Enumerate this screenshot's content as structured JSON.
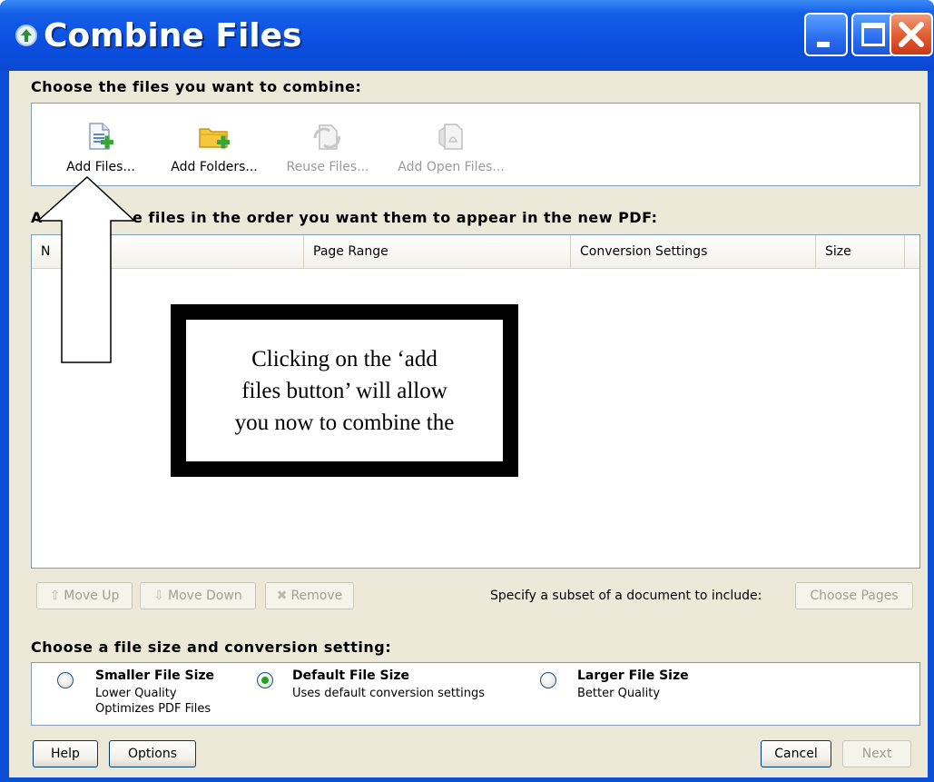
{
  "window": {
    "title": "Combine Files"
  },
  "choose_section": {
    "title": "Choose the files you want to combine:",
    "tools": [
      {
        "label": "Add Files...",
        "enabled": true,
        "icon": "add-files-icon"
      },
      {
        "label": "Add Folders...",
        "enabled": true,
        "icon": "add-folders-icon"
      },
      {
        "label": "Reuse Files...",
        "enabled": false,
        "icon": "reuse-files-icon"
      },
      {
        "label": "Add Open Files...",
        "enabled": false,
        "icon": "add-open-files-icon"
      }
    ]
  },
  "arrange_section": {
    "title_visible_start": "A",
    "title_visible_end": "e files in the order you want them to appear in the new PDF:",
    "columns": [
      "N",
      "Page Range",
      "Conversion Settings",
      "Size"
    ],
    "buttons": {
      "move_up": "Move Up",
      "move_down": "Move Down",
      "remove": "Remove",
      "choose_pages": "Choose Pages"
    },
    "subset_label": "Specify a subset of a document to include:"
  },
  "size_section": {
    "title": "Choose a file size and conversion setting:",
    "options": [
      {
        "title": "Smaller File Size",
        "line1": "Lower Quality",
        "line2": "Optimizes PDF Files",
        "selected": false
      },
      {
        "title": "Default File Size",
        "line1": "Uses default conversion settings",
        "line2": "",
        "selected": true
      },
      {
        "title": "Larger File Size",
        "line1": "Better Quality",
        "line2": "",
        "selected": false
      }
    ]
  },
  "footer": {
    "help": "Help",
    "options": "Options",
    "cancel": "Cancel",
    "next": "Next"
  },
  "annotation": {
    "lines": [
      "Clicking on the ‘add",
      "files button’ will allow",
      "you now to combine the"
    ]
  },
  "colors": {
    "titlebar": "#0a4fd6",
    "close_button": "#e25a2e",
    "dialog_background": "#ece9d8",
    "radio_selected": "#21a121"
  }
}
